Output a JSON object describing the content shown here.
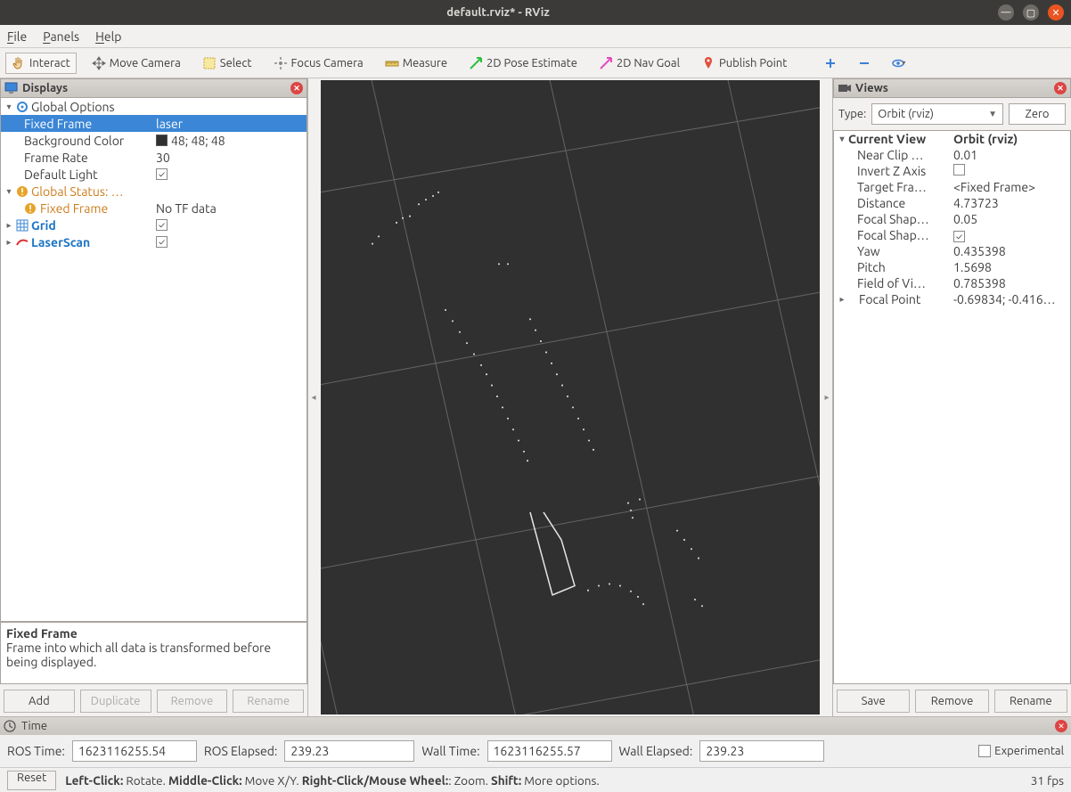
{
  "window": {
    "title": "default.rviz* - RViz"
  },
  "menu": {
    "file": "File",
    "panels": "Panels",
    "help": "Help"
  },
  "toolbar": {
    "interact": "Interact",
    "move_camera": "Move Camera",
    "select": "Select",
    "focus_camera": "Focus Camera",
    "measure": "Measure",
    "pose_estimate": "2D Pose Estimate",
    "nav_goal": "2D Nav Goal",
    "publish_point": "Publish Point"
  },
  "displays": {
    "title": "Displays",
    "items": {
      "global_options": "Global Options",
      "fixed_frame": {
        "label": "Fixed Frame",
        "value": "laser"
      },
      "background_color": {
        "label": "Background Color",
        "value": "48; 48; 48"
      },
      "frame_rate": {
        "label": "Frame Rate",
        "value": "30"
      },
      "default_light": {
        "label": "Default Light",
        "checked": true
      },
      "global_status": "Global Status: …",
      "status_fixed_frame": {
        "label": "Fixed Frame",
        "value": "No TF data"
      },
      "grid": {
        "label": "Grid",
        "checked": true
      },
      "laser_scan": {
        "label": "LaserScan",
        "checked": true
      }
    },
    "desc": {
      "title": "Fixed Frame",
      "body": "Frame into which all data is transformed before being displayed."
    },
    "buttons": {
      "add": "Add",
      "duplicate": "Duplicate",
      "remove": "Remove",
      "rename": "Rename"
    }
  },
  "views": {
    "title": "Views",
    "type_label": "Type:",
    "type_value": "Orbit (rviz)",
    "zero": "Zero",
    "rows": {
      "current_view": {
        "label": "Current View",
        "value": "Orbit (rviz)"
      },
      "near_clip": {
        "label": "Near Clip …",
        "value": "0.01"
      },
      "invert_z": {
        "label": "Invert Z Axis",
        "checked": false
      },
      "target_frame": {
        "label": "Target Fra…",
        "value": "<Fixed Frame>"
      },
      "distance": {
        "label": "Distance",
        "value": "4.73723"
      },
      "focal_shape1": {
        "label": "Focal Shap…",
        "value": "0.05"
      },
      "focal_shape2": {
        "label": "Focal Shap…",
        "checked": true
      },
      "yaw": {
        "label": "Yaw",
        "value": "0.435398"
      },
      "pitch": {
        "label": "Pitch",
        "value": "1.5698"
      },
      "fov": {
        "label": "Field of Vi…",
        "value": "0.785398"
      },
      "focal_point": {
        "label": "Focal Point",
        "value": "-0.69834; -0.416…"
      }
    },
    "buttons": {
      "save": "Save",
      "remove": "Remove",
      "rename": "Rename"
    }
  },
  "time": {
    "title": "Time",
    "ros_time_label": "ROS Time:",
    "ros_time": "1623116255.54",
    "ros_elapsed_label": "ROS Elapsed:",
    "ros_elapsed": "239.23",
    "wall_time_label": "Wall Time:",
    "wall_time": "1623116255.57",
    "wall_elapsed_label": "Wall Elapsed:",
    "wall_elapsed": "239.23",
    "experimental": "Experimental"
  },
  "status": {
    "reset": "Reset",
    "help_pre": "Left-Click:",
    "help_1": " Rotate. ",
    "help_mid": "Middle-Click:",
    "help_2": " Move X/Y. ",
    "help_right": "Right-Click/Mouse Wheel:",
    "help_3": ": Zoom. ",
    "help_shift": "Shift:",
    "help_4": " More options.",
    "fps": "31 fps"
  }
}
